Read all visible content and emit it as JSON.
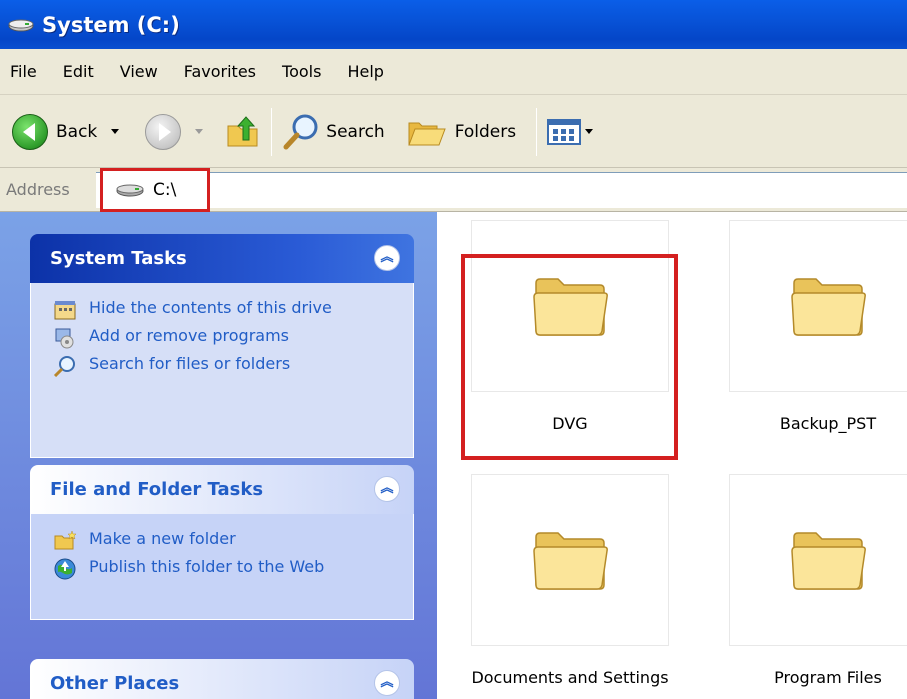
{
  "window": {
    "title": "System (C:)"
  },
  "menu": [
    "File",
    "Edit",
    "View",
    "Favorites",
    "Tools",
    "Help"
  ],
  "toolbar": {
    "back_label": "Back",
    "search_label": "Search",
    "folders_label": "Folders"
  },
  "address": {
    "label": "Address",
    "value": "C:\\"
  },
  "left_panels": {
    "system_tasks": {
      "title": "System Tasks",
      "items": [
        "Hide the contents of this drive",
        "Add or remove programs",
        "Search for files or folders"
      ]
    },
    "file_folder_tasks": {
      "title": "File and Folder Tasks",
      "items": [
        "Make a new folder",
        "Publish this folder to the Web"
      ]
    },
    "other_places": {
      "title": "Other Places"
    }
  },
  "folders": [
    "DVG",
    "Backup_PST",
    "Documents and Settings",
    "Program Files"
  ],
  "colors": {
    "highlight": "#d42020",
    "task_link": "#215dc6",
    "title_bar": "#0a5ee8"
  }
}
